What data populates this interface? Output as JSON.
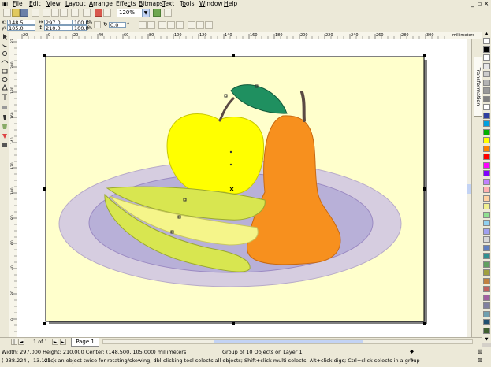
{
  "menu": [
    "File",
    "Edit",
    "View",
    "Layout",
    "Arrange",
    "Effects",
    "Bitmaps",
    "Text",
    "Tools",
    "Window",
    "Help"
  ],
  "menu_underline": [
    "F",
    "E",
    "V",
    "L",
    "A",
    "c",
    "B",
    "T",
    "o",
    "W",
    "H"
  ],
  "toolbar": {
    "zoom": "120%"
  },
  "properties": {
    "x": "148.5 mm",
    "y": "105.0 mm",
    "width": "297.0 mm",
    "height": "210.0 mm",
    "scale_x": "100.0",
    "scale_y": "100.0",
    "percent": "%",
    "rotation": "0.0",
    "rotation_unit": "°"
  },
  "rulers": {
    "horizontal_ticks": [
      "20",
      "0",
      "20",
      "40",
      "60",
      "80",
      "100",
      "120",
      "140",
      "160",
      "180",
      "200",
      "220",
      "240",
      "260",
      "280",
      "300"
    ],
    "horizontal_unit": "millimeters",
    "vertical_ticks": [
      "220",
      "200",
      "180",
      "160",
      "140",
      "120",
      "100",
      "80",
      "60",
      "40",
      "20",
      "0"
    ]
  },
  "docker": {
    "label": "Transformation"
  },
  "page_nav": {
    "count": "1 of 1",
    "active_tab": "Page 1"
  },
  "status": {
    "dimensions": "Width: 297.000  Height: 210.000  Center: (148.500, 105.000)  millimeters",
    "selection": "Group of 10 Objects on Layer 1",
    "coords": "( 238.224 , -13.121 )",
    "hint": "Click an object twice for rotating/skewing; dbl-clicking tool selects all objects; Shift+click multi-selects; Alt+click digs; Ctrl+click selects in a group"
  },
  "colors": {
    "page": "#ffffcc",
    "plate_outer": "#d6cde0",
    "plate_inner": "#b8b0d8",
    "apple": "#ffff00",
    "leaf": "#1f9060",
    "pear": "#f7901e",
    "banana": "#d8e650",
    "banana_light": "#f5f58a"
  },
  "palette": [
    "#ffffff",
    "#000000",
    "#ffffff",
    "#e6e6e6",
    "#cccccc",
    "#b3b3b3",
    "#999999",
    "#808080",
    "#ffffff",
    "#2f3fa0",
    "#00a0e0",
    "#00b000",
    "#ffff00",
    "#ff8000",
    "#ff0000",
    "#ff00ff",
    "#8000ff",
    "#c080ff",
    "#ffb0b0",
    "#ffd0a0",
    "#f0f090",
    "#90e090",
    "#90d0f0",
    "#a0a0f0",
    "#d8d8d8",
    "#6080c0",
    "#309090",
    "#60a060",
    "#a0a040",
    "#c08040",
    "#c06060",
    "#a060a0",
    "#8080a0",
    "#70a0b0",
    "#205070",
    "#406030"
  ]
}
